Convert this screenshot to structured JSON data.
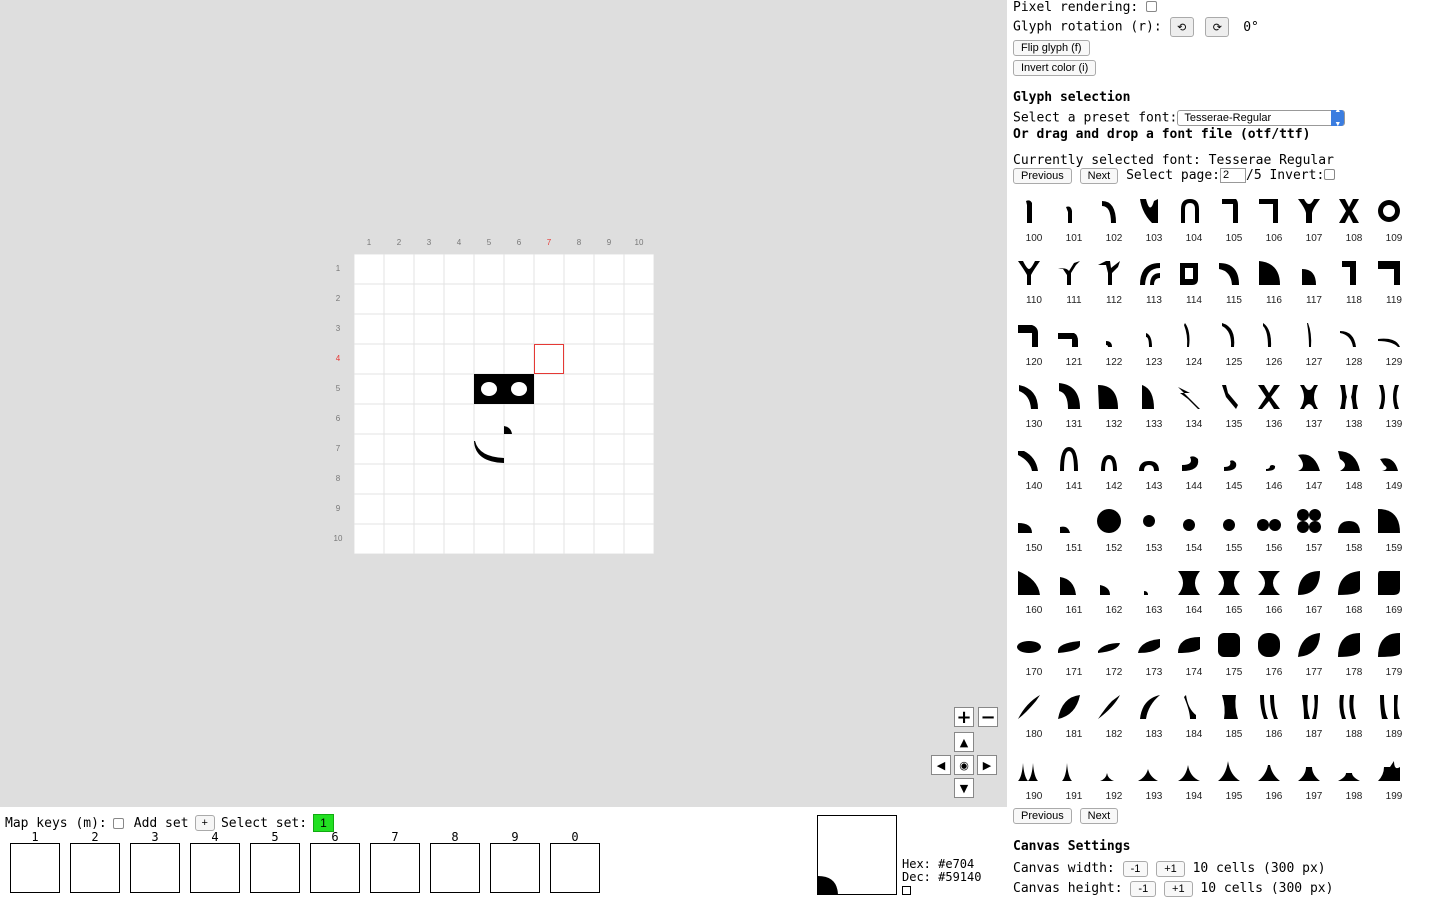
{
  "canvas": {
    "columns": [
      "1",
      "2",
      "3",
      "4",
      "5",
      "6",
      "7",
      "8",
      "9",
      "10"
    ],
    "rows": [
      "1",
      "2",
      "3",
      "4",
      "5",
      "6",
      "7",
      "8",
      "9",
      "10"
    ],
    "highlight_col": "7",
    "highlight_row": "4",
    "accent_color": "#e53935",
    "zoom_in": "+",
    "zoom_out": "−",
    "pan_up": "▲",
    "pan_down": "▼",
    "pan_left": "◀",
    "pan_right": "▶",
    "pan_center": "◉"
  },
  "bottom": {
    "map_keys_label": "Map keys (m):",
    "add_set_label": "Add set",
    "add_set_btn": "+",
    "select_set_label": "Select set:",
    "selected_set": "1",
    "slots": [
      "1",
      "2",
      "3",
      "4",
      "5",
      "6",
      "7",
      "8",
      "9",
      "0"
    ],
    "hex": "Hex: #e704",
    "dec": "Dec: #59140"
  },
  "panel": {
    "pixel_rendering": "Pixel rendering:",
    "glyph_rotation": "Glyph rotation (r):",
    "rotate_ccw": "⟲",
    "rotate_cw": "⟳",
    "rotation_value": "0°",
    "flip_glyph": "Flip glyph (f)",
    "invert_color": "Invert color (i)",
    "glyph_selection_heading": "Glyph selection",
    "preset_label": "Select a preset font:",
    "preset_value": "Tesserae-Regular",
    "drag_drop": "Or drag and drop a font file (otf/ttf)",
    "current_font": "Currently selected font: Tesserae Regular",
    "prev": "Previous",
    "next": "Next",
    "select_page_label": "Select page:",
    "page_value": "2",
    "page_total": "/5",
    "invert_label": "Invert:",
    "prev_bottom": "Previous",
    "next_bottom": "Next",
    "canvas_settings_heading": "Canvas Settings",
    "canvas_width_label": "Canvas width:",
    "canvas_height_label": "Canvas height:",
    "minus_one": "-1",
    "plus_one": "+1",
    "width_value": "10 cells (300 px)",
    "height_value": "10 cells (300 px)"
  },
  "glyph_numbers": [
    "100",
    "101",
    "102",
    "103",
    "104",
    "105",
    "106",
    "107",
    "108",
    "109",
    "110",
    "111",
    "112",
    "113",
    "114",
    "115",
    "116",
    "117",
    "118",
    "119",
    "120",
    "121",
    "122",
    "123",
    "124",
    "125",
    "126",
    "127",
    "128",
    "129",
    "130",
    "131",
    "132",
    "133",
    "134",
    "135",
    "136",
    "137",
    "138",
    "139",
    "140",
    "141",
    "142",
    "143",
    "144",
    "145",
    "146",
    "147",
    "148",
    "149",
    "150",
    "151",
    "152",
    "153",
    "154",
    "155",
    "156",
    "157",
    "158",
    "159",
    "160",
    "161",
    "162",
    "163",
    "164",
    "165",
    "166",
    "167",
    "168",
    "169",
    "170",
    "171",
    "172",
    "173",
    "174",
    "175",
    "176",
    "177",
    "178",
    "179",
    "180",
    "181",
    "182",
    "183",
    "184",
    "185",
    "186",
    "187",
    "188",
    "189",
    "190",
    "191",
    "192",
    "193",
    "194",
    "195",
    "196",
    "197",
    "198",
    "199"
  ]
}
